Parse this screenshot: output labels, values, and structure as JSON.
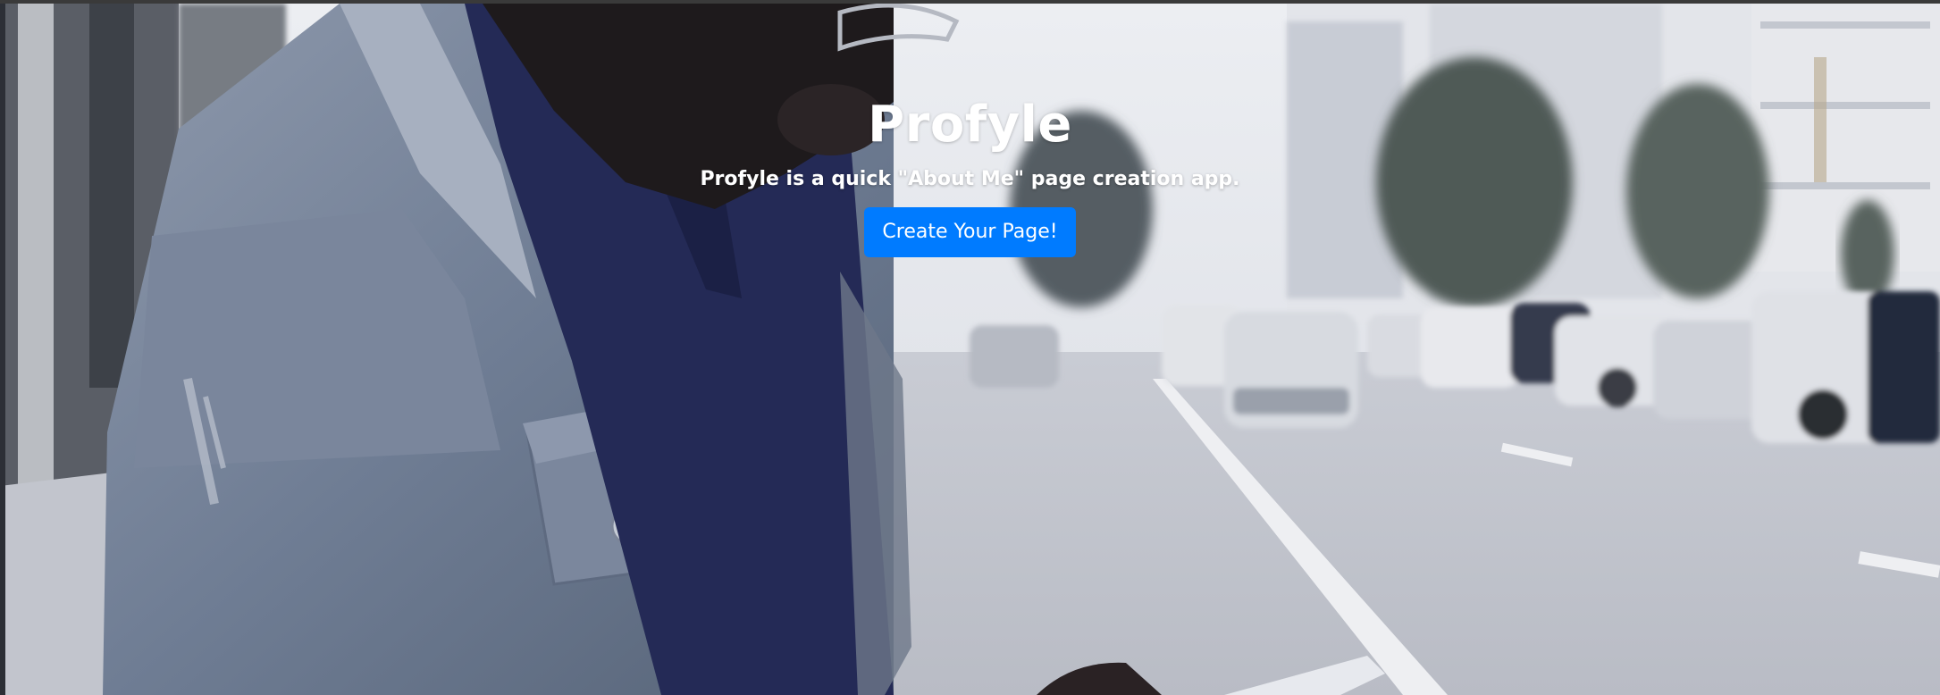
{
  "hero": {
    "title": "Profyle",
    "subtitle": "Profyle is a quick \"About Me\" page creation app.",
    "cta_label": "Create Your Page!",
    "background_description_icon": "street-photo-background"
  },
  "colors": {
    "cta_background": "#007bff",
    "cta_text": "#ffffff",
    "title_text": "#ffffff"
  }
}
